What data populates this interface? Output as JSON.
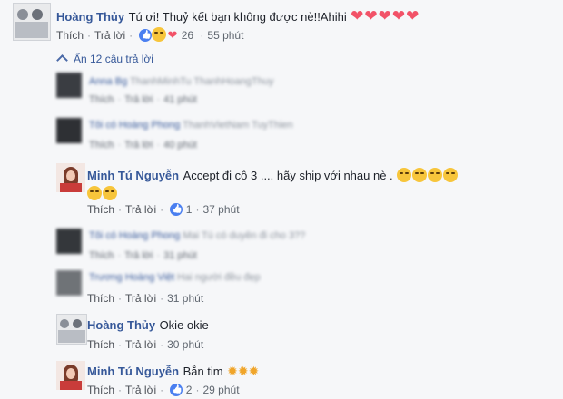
{
  "top": {
    "author": "Hoàng Thủy",
    "text": "Tú ơi! Thuỷ kết bạn không được nè!!Ahihi",
    "hearts": "❤❤❤❤❤",
    "like": "Thích",
    "reply": "Trả lời",
    "reactions": "26",
    "time": "55 phút"
  },
  "replies_toggle": "Ẩn 12 câu trả lời",
  "blurred": [
    {
      "name": "Anna Bg",
      "text": "ThanhMinhTu ThanhHoangThuy"
    },
    {
      "name": "Tôi có Hoàng Phong",
      "text": "ThanhVietNam TuyThien"
    },
    {
      "name": "Tôi có Hoàng Phong",
      "text": "Mai Tú có duyên đi cho 3??"
    },
    {
      "name": "Trương Hoàng Việt",
      "text": "Hai người đều đẹp"
    }
  ],
  "r1": {
    "author": "Minh Tú Nguyễn",
    "text": "Accept đi cô 3 .... hãy ship với nhau nè .",
    "like": "Thích",
    "reply": "Trả lời",
    "count": "1",
    "time": "37 phút"
  },
  "b1": {
    "like": "Thích",
    "reply": "Trả lời",
    "time": "41 phút"
  },
  "b2": {
    "like": "Thích",
    "reply": "Trả lời",
    "time": "40 phút"
  },
  "b3": {
    "like": "Thích",
    "reply": "Trả lời",
    "time": "31 phút"
  },
  "b4": {
    "like": "Thích",
    "reply": "Trả lời",
    "time": "31 phút"
  },
  "r2": {
    "author": "Hoàng Thủy",
    "text": "Okie okie",
    "like": "Thích",
    "reply": "Trả lời",
    "time": "30 phút"
  },
  "r3": {
    "author": "Minh Tú Nguyễn",
    "text": "Bắn tim",
    "like": "Thích",
    "reply": "Trả lời",
    "count": "2",
    "time": "29 phút"
  }
}
